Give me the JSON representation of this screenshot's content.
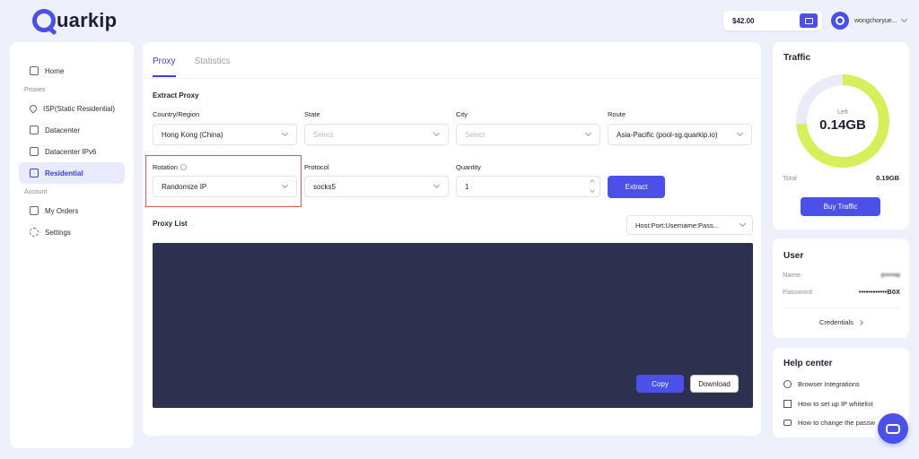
{
  "brand": {
    "name": "uarkip",
    "icon": "quarkip-q-logo-icon"
  },
  "header": {
    "balance": "$42.00",
    "wallet_icon": "wallet-icon",
    "username": "wongchoryue..."
  },
  "sidebar": {
    "items": [
      {
        "label": "Home",
        "icon": "home-icon"
      }
    ],
    "proxies_section": "Proxies",
    "proxy_items": [
      {
        "label": "ISP(Static Residential)",
        "icon": "location-pin-icon"
      },
      {
        "label": "Datacenter",
        "icon": "server-icon"
      },
      {
        "label": "Datacenter IPv6",
        "icon": "monitor-icon"
      },
      {
        "label": "Residential",
        "icon": "residential-icon",
        "active": true
      }
    ],
    "account_section": "Account",
    "account_items": [
      {
        "label": "My Orders",
        "icon": "orders-icon"
      },
      {
        "label": "Settings",
        "icon": "gear-icon"
      }
    ]
  },
  "main": {
    "tabs": [
      {
        "label": "Proxy",
        "active": true
      },
      {
        "label": "Statistics",
        "active": false
      }
    ],
    "extract_title": "Extract Proxy",
    "fields": {
      "country_label": "Country/Region",
      "country_value": "Hong Kong (China)",
      "state_label": "State",
      "state_value": "Select",
      "city_label": "City",
      "city_value": "Select",
      "route_label": "Route",
      "route_value": "Asia-Pacific (pool-sg.quarkip.io)",
      "rotation_label": "Rotation",
      "rotation_value": "Randomize IP",
      "protocol_label": "Protocol",
      "protocol_value": "socks5",
      "quantity_label": "Quantity",
      "quantity_value": "1"
    },
    "extract_button": "Extract",
    "proxy_list_title": "Proxy List",
    "format_value": "Host:Port:Username:Pass...",
    "copy_button": "Copy",
    "download_button": "Download"
  },
  "traffic": {
    "title": "Traffic",
    "left_label": "Left",
    "left_value": "0.14GB",
    "left_fraction": 0.74,
    "total_label": "Total",
    "total_value": "0.19GB",
    "buy_button": "Buy Traffic",
    "colors": {
      "used": "#d4f05a",
      "remaining": "#e8ecf8"
    }
  },
  "user_card": {
    "title": "User",
    "name_label": "Name",
    "name_value": "z•••••o",
    "password_label": "Password",
    "password_value": "••••••••••••B0X",
    "credentials_link": "Credentials"
  },
  "help": {
    "title": "Help center",
    "items": [
      {
        "label": "Browser Integrations",
        "icon": "globe-icon"
      },
      {
        "label": "How to set up IP whitelist",
        "icon": "whitelist-icon"
      },
      {
        "label": "How to change the passw",
        "icon": "lock-icon"
      }
    ]
  },
  "accent_color": "#4a50e8"
}
